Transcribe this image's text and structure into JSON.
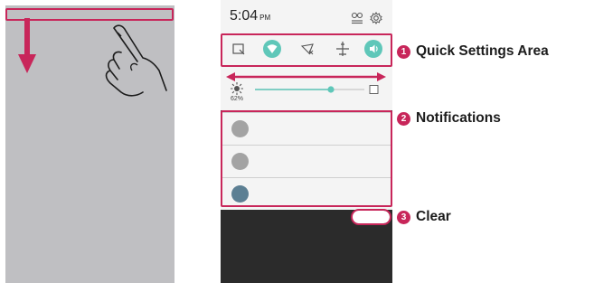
{
  "status_bar": {
    "time": "5:04",
    "ampm": "PM"
  },
  "head_icons": [
    "nearby-devices-icon",
    "settings-gear-icon"
  ],
  "quick_settings": [
    "screenshot-icon",
    "wifi-icon",
    "location-icon",
    "airplane-mode-icon",
    "sound-icon"
  ],
  "brightness": {
    "percent_label": "62%",
    "level": 0.62
  },
  "notifications": [
    {
      "color": "#a3a3a3"
    },
    {
      "color": "#a3a3a3"
    },
    {
      "color": "#5c7f93"
    }
  ],
  "callouts": [
    {
      "number": "1",
      "label": "Quick Settings Area"
    },
    {
      "number": "2",
      "label": "Notifications"
    },
    {
      "number": "3",
      "label": "Clear"
    }
  ],
  "colors": {
    "accent": "#c8265a",
    "toggle_on": "#5fc7b9",
    "shade": "#f4f4f4",
    "phone_bg": "#bfbfc2",
    "dark_bg": "#2b2b2b"
  }
}
